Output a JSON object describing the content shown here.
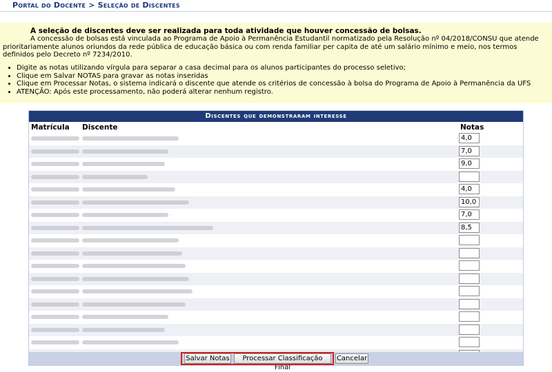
{
  "breadcrumb": "Portal do Docente > Seleção de Discentes",
  "notice": {
    "title": "A seleção de discentes deve ser realizada para toda atividade que houver concessão de bolsas.",
    "body": "A concessão de bolsas está vinculada ao Programa de Apoio à Permanência Estudantil normatizado pela Resolução nº 04/2018/CONSU que atende prioritariamente alunos oriundos da rede pública de educação básica ou com renda familiar per capita de até um salário mínimo e meio, nos termos definidos pelo Decreto nº 7234/2010.",
    "bullets": [
      "Digite as notas utilizando vírgula para separar a casa decimal para os alunos participantes do processo seletivo;",
      "Clique em Salvar NOTAS para gravar as notas inseridas",
      "Clique em Processar Notas, o sistema indicará o discente que atende os critérios de concessão à bolsa do Programa de Apoio à Permanência da UFS",
      "ATENÇÃO: Após este processamento, não poderá alterar nenhum registro."
    ]
  },
  "table": {
    "caption": "Discentes que demonstraram interesse",
    "headers": {
      "matricula": "Matrícula",
      "discente": "Discente",
      "notas": "Notas"
    },
    "grades": [
      "4,0",
      "7,0",
      "9,0",
      "",
      "4,0",
      "10,0",
      "7,0",
      "8,5",
      "",
      "",
      "",
      "",
      "",
      "",
      "",
      "",
      "",
      ""
    ]
  },
  "buttons": {
    "save": "Salvar Notas",
    "process": "Processar Classificação Final",
    "cancel": "Cancelar"
  },
  "colors": {
    "header_bg": "#1f3b78",
    "highlight": "#d11f1f",
    "notice_bg": "#fdfbd3"
  }
}
